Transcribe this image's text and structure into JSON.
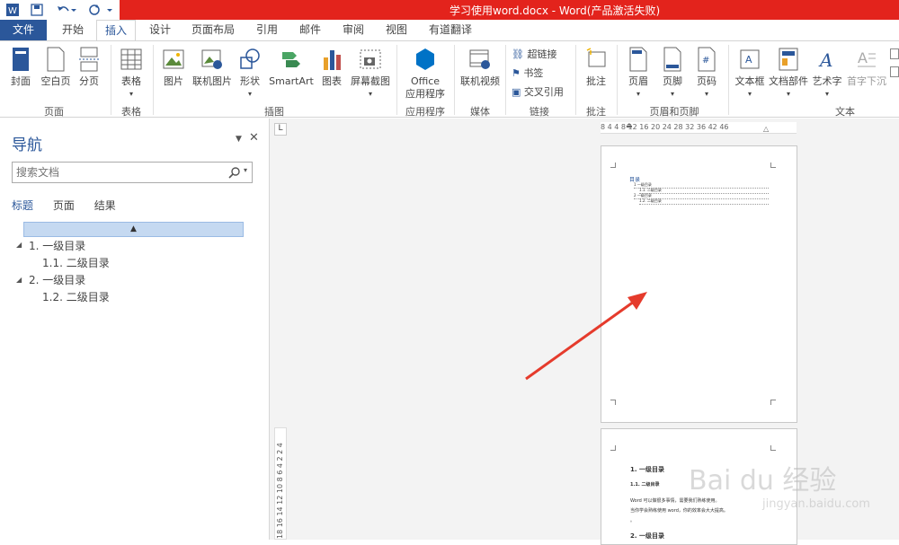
{
  "title_bar": {
    "title": "学习使用word.docx - Word(产品激活失败)"
  },
  "tabs": [
    "文件",
    "开始",
    "插入",
    "设计",
    "页面布局",
    "引用",
    "邮件",
    "审阅",
    "视图",
    "有道翻译"
  ],
  "ribbon": {
    "pages": {
      "cover": "封面",
      "blank": "空白页",
      "break": "分页",
      "group": "页面"
    },
    "tables": {
      "table": "表格",
      "group": "表格"
    },
    "illustrations": {
      "picture": "图片",
      "online_picture": "联机图片",
      "shapes": "形状",
      "smartart": "SmartArt",
      "chart": "图表",
      "screenshot": "屏幕截图",
      "group": "插图"
    },
    "apps": {
      "office_line1": "Office",
      "office_line2": "应用程序",
      "group": "应用程序"
    },
    "media": {
      "online_video": "联机视频",
      "group": "媒体"
    },
    "links": {
      "hyperlink": "超链接",
      "bookmark": "书签",
      "crossref": "交叉引用",
      "group": "链接"
    },
    "comments": {
      "comment": "批注",
      "group": "批注"
    },
    "header_footer": {
      "header": "页眉",
      "footer": "页脚",
      "page_number": "页码",
      "group": "页眉和页脚"
    },
    "text": {
      "textbox": "文本框",
      "quick_parts": "文档部件",
      "wordart": "艺术字",
      "dropcap": "首字下沉",
      "group": "文本"
    }
  },
  "nav": {
    "title": "导航",
    "search_placeholder": "搜索文档",
    "tabs": [
      "标题",
      "页面",
      "结果"
    ],
    "headings": [
      {
        "label": "1. 一级目录",
        "level": 1
      },
      {
        "label": "1.1. 二级目录",
        "level": 2
      },
      {
        "label": "2. 一级目录",
        "level": 1
      },
      {
        "label": "1.2. 二级目录",
        "level": 2
      }
    ]
  },
  "ruler": {
    "h_ticks": "8  4     4  8  12  16  20  24  28  32  36    42  46",
    "v_ticks": "18 16 14 12 10 8 6 4 2  2 4",
    "corner": "L"
  },
  "page1": {
    "toc_title": "目录",
    "lines": [
      "1 一级目录",
      "1.1. 二级目录",
      "2 一级目录",
      "1.2. 二级目录"
    ]
  },
  "page2": {
    "h1": "1. 一级目录",
    "h2": "1.1. 二级目录",
    "body1": "Word 可以做很多事情，需要我们熟练使用。",
    "body2": "当你学会熟练使用 word，你的效率会大大提高。",
    "body3": "。",
    "h1b": "2. 一级目录"
  },
  "watermark": {
    "brand": "Bai du 经验",
    "url": "jingyan.baidu.com"
  },
  "colors": {
    "accent": "#2b579a",
    "titlebar": "#e3231c",
    "arrow": "#e53b2c",
    "nav_highlight": "#c5d9f1"
  }
}
